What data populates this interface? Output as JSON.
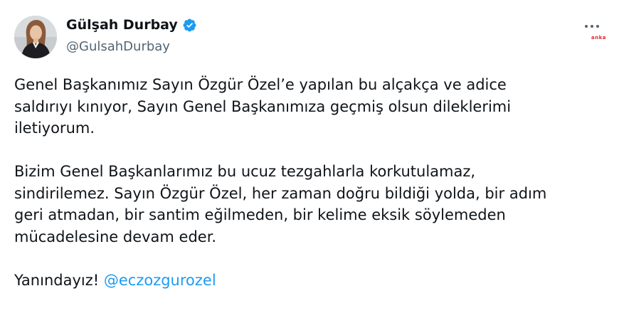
{
  "author": {
    "display_name": "Gülşah Durbay",
    "handle": "@GulsahDurbay",
    "verified_icon": "verified-badge-icon",
    "avatar": "avatar-photo"
  },
  "more_menu_icon": "more-options-icon",
  "watermark": "anka",
  "colors": {
    "verified": "#1d9bf0",
    "mention": "#1d9bf0",
    "handle": "#536471",
    "text": "#0f1419",
    "watermark": "#e0262b"
  },
  "tweet": {
    "paragraphs": [
      [
        "Genel Başkanımız Sayın Özgür Özel’e yapılan bu alçakça ve adice",
        "saldırıyı kınıyor, Sayın Genel Başkanımıza geçmiş olsun dileklerimi",
        "iletiyorum."
      ],
      [
        "Bizim Genel Başkanlarımız bu ucuz tezgahlarla korkutulamaz,",
        "sindirilemez. Sayın Özgür Özel, her zaman doğru bildiği yolda, bir adım",
        "geri atmadan, bir santim eğilmeden, bir kelime eksik söylemeden",
        "mücadelesine devam eder."
      ]
    ],
    "closing_text": "Yanındayız!",
    "mention": "@eczozgurozel"
  }
}
